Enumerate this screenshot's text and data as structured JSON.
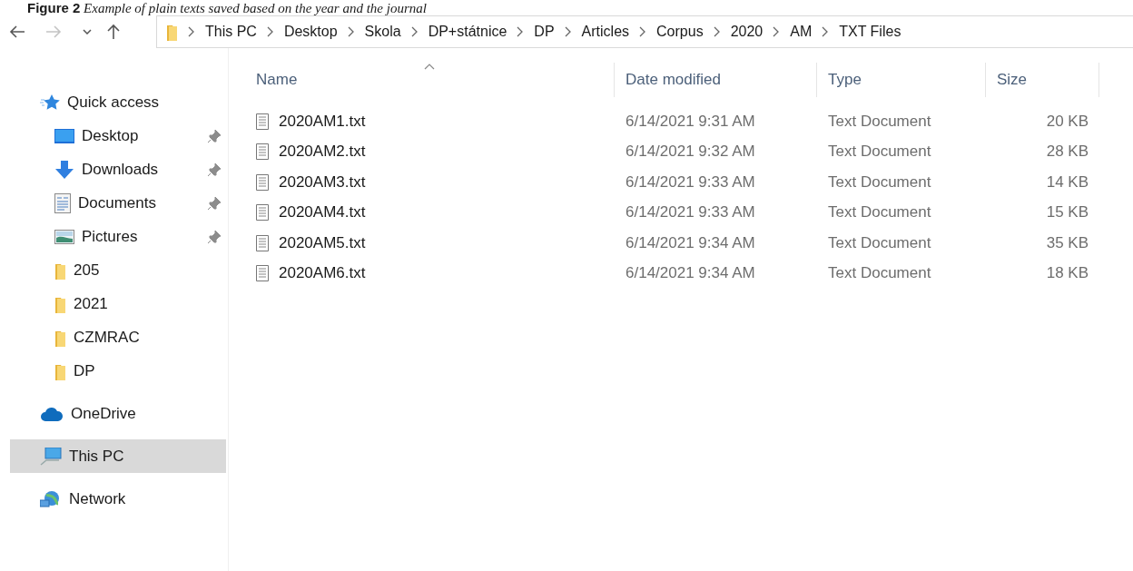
{
  "caption": {
    "label": "Figure 2",
    "text": "Example of plain texts saved based on the year and the journal"
  },
  "navigation": [
    {
      "kind": "back",
      "disabled": false
    },
    {
      "kind": "forward",
      "disabled": true
    },
    {
      "kind": "recent",
      "disabled": false
    },
    {
      "kind": "up",
      "disabled": false
    }
  ],
  "address_bar": {
    "crumbs": [
      "This PC",
      "Desktop",
      "Skola",
      "DP+státnice",
      "DP",
      "Articles",
      "Corpus",
      "2020",
      "AM",
      "TXT Files"
    ]
  },
  "sidebar": {
    "items": [
      {
        "label": "Quick access",
        "kind": "quick-access",
        "selected": false,
        "children": [
          {
            "label": "Desktop",
            "kind": "desktop",
            "pinned": true,
            "selected": false
          },
          {
            "label": "Downloads",
            "kind": "downloads",
            "pinned": true,
            "selected": false
          },
          {
            "label": "Documents",
            "kind": "documents",
            "pinned": true,
            "selected": false
          },
          {
            "label": "Pictures",
            "kind": "pictures",
            "pinned": true,
            "selected": false
          },
          {
            "label": "205",
            "kind": "folder",
            "pinned": false,
            "selected": false
          },
          {
            "label": "2021",
            "kind": "folder",
            "pinned": false,
            "selected": false
          },
          {
            "label": "CZMRAC",
            "kind": "folder",
            "pinned": false,
            "selected": false
          },
          {
            "label": "DP",
            "kind": "folder",
            "pinned": false,
            "selected": false
          }
        ]
      },
      {
        "label": "OneDrive",
        "kind": "onedrive",
        "selected": false
      },
      {
        "label": "This PC",
        "kind": "computer",
        "selected": true
      },
      {
        "label": "Network",
        "kind": "network",
        "selected": false
      }
    ]
  },
  "table": {
    "columns": [
      {
        "label": "Name",
        "sorted": true
      },
      {
        "label": "Date modified",
        "sorted": false
      },
      {
        "label": "Type",
        "sorted": false
      },
      {
        "label": "Size",
        "sorted": false
      }
    ],
    "rows": [
      [
        "2020AM1.txt",
        "6/14/2021 9:31 AM",
        "Text Document",
        "20 KB"
      ],
      [
        "2020AM2.txt",
        "6/14/2021 9:32 AM",
        "Text Document",
        "28 KB"
      ],
      [
        "2020AM3.txt",
        "6/14/2021 9:33 AM",
        "Text Document",
        "14 KB"
      ],
      [
        "2020AM4.txt",
        "6/14/2021 9:33 AM",
        "Text Document",
        "15 KB"
      ],
      [
        "2020AM5.txt",
        "6/14/2021 9:34 AM",
        "Text Document",
        "35 KB"
      ],
      [
        "2020AM6.txt",
        "6/14/2021 9:34 AM",
        "Text Document",
        "18 KB"
      ]
    ]
  }
}
